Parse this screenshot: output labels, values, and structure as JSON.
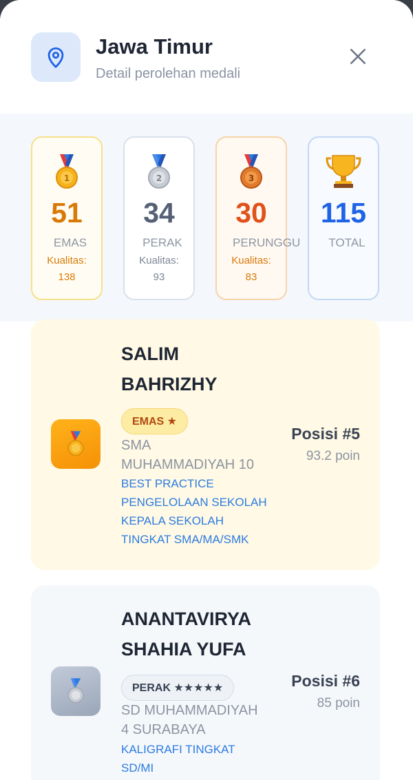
{
  "header": {
    "title": "Jawa Timur",
    "subtitle": "Detail perolehan medali",
    "location_icon": "map-pin-icon",
    "close_icon": "close-icon"
  },
  "stats": [
    {
      "icon": "gold-medal-icon",
      "value": "51",
      "label": "EMAS",
      "quality_label": "Kualitas:",
      "quality_value": "138"
    },
    {
      "icon": "silver-medal-icon",
      "value": "34",
      "label": "PERAK",
      "quality_label": "Kualitas:",
      "quality_value": "93"
    },
    {
      "icon": "bronze-medal-icon",
      "value": "30",
      "label": "PERUNGGU",
      "quality_label": "Kualitas:",
      "quality_value": "83"
    },
    {
      "icon": "trophy-icon",
      "value": "115",
      "label": "TOTAL"
    }
  ],
  "participants": [
    {
      "name_lines": [
        "SALIM",
        "BAHRIZHY"
      ],
      "medal_icon": "gold-medal-icon",
      "badge": "EMAS ★",
      "school_lines": [
        "SMA",
        "MUHAMMADIYAH 10"
      ],
      "category_lines": [
        "BEST PRACTICE",
        "PENGELOLAAN SEKOLAH",
        "KEPALA SEKOLAH",
        "TINGKAT SMA/MA/SMK"
      ],
      "position": "Posisi #5",
      "points": "93.2 poin"
    },
    {
      "name_lines": [
        "ANANTAVIRYA",
        "SHAHIA YUFA"
      ],
      "medal_icon": "silver-medal-icon",
      "badge": "PERAK ★★★★★",
      "school_lines": [
        "SD MUHAMMADIYAH",
        "4 SURABAYA"
      ],
      "category_lines": [
        "KALIGRAFI TINGKAT",
        "SD/MI"
      ],
      "position": "Posisi #6",
      "points": "85 poin"
    }
  ],
  "colors": {
    "gold": "#d97a08",
    "silver": "#556076",
    "bronze": "#e0521a",
    "total": "#1f63e6",
    "link": "#2b7be0"
  }
}
